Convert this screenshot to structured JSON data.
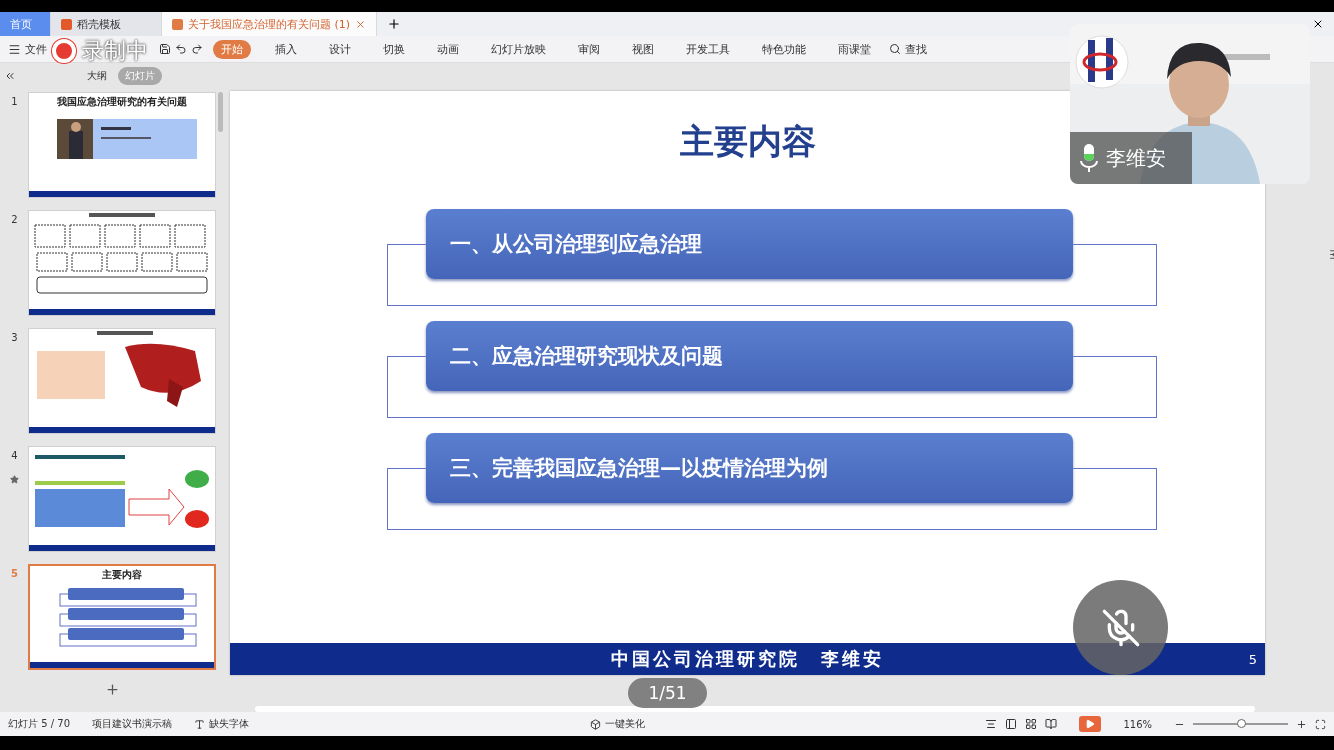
{
  "tabs": [
    {
      "label": "首页",
      "selected": false,
      "kind": "home"
    },
    {
      "label": "稻壳模板",
      "selected": false,
      "kind": "docer"
    },
    {
      "label": "关于我国应急治理的有关问题 (1)",
      "selected": true,
      "kind": "doc"
    }
  ],
  "file_menu": "文件",
  "ribbon_tabs": [
    {
      "label": "开始",
      "selected": true
    },
    {
      "label": "插入",
      "selected": false
    },
    {
      "label": "设计",
      "selected": false
    },
    {
      "label": "切换",
      "selected": false
    },
    {
      "label": "动画",
      "selected": false
    },
    {
      "label": "幻灯片放映",
      "selected": false
    },
    {
      "label": "审阅",
      "selected": false
    },
    {
      "label": "视图",
      "selected": false
    },
    {
      "label": "开发工具",
      "selected": false
    },
    {
      "label": "特色功能",
      "selected": false
    },
    {
      "label": "雨课堂",
      "selected": false
    }
  ],
  "search_label": "查找",
  "panel_tabs": [
    {
      "label": "大纲",
      "selected": false
    },
    {
      "label": "幻灯片",
      "selected": true
    }
  ],
  "thumbnails": [
    {
      "number": "1",
      "kind": "title",
      "title": "我国应急治理研究的有关问题",
      "selected": false,
      "starred": false
    },
    {
      "number": "2",
      "kind": "diagram",
      "selected": false,
      "starred": false
    },
    {
      "number": "3",
      "kind": "map",
      "selected": false,
      "starred": false
    },
    {
      "number": "4",
      "kind": "arrow",
      "selected": false,
      "starred": true
    },
    {
      "number": "5",
      "kind": "contents",
      "title": "主要内容",
      "selected": true,
      "starred": false
    }
  ],
  "slide": {
    "title": "主要内容",
    "items": [
      "一、从公司治理到应急治理",
      "二、应急治理研究现状及问题",
      "三、完善我国应急治理—以疫情治理为例"
    ],
    "footer": "中国公司治理研究院　李维安",
    "page_number": "5"
  },
  "video": {
    "name": "李维安",
    "mic": {
      "level": 0.4
    }
  },
  "recording": "录制中",
  "page_counter": "1/51",
  "status_bar": {
    "slide_info": "幻灯片 5 / 70",
    "theme": "项目建议书演示稿",
    "missing_fonts": "缺失字体",
    "beautify": "一键美化",
    "zoom": "116%",
    "zoom_slider": {
      "level": 0.5
    }
  }
}
